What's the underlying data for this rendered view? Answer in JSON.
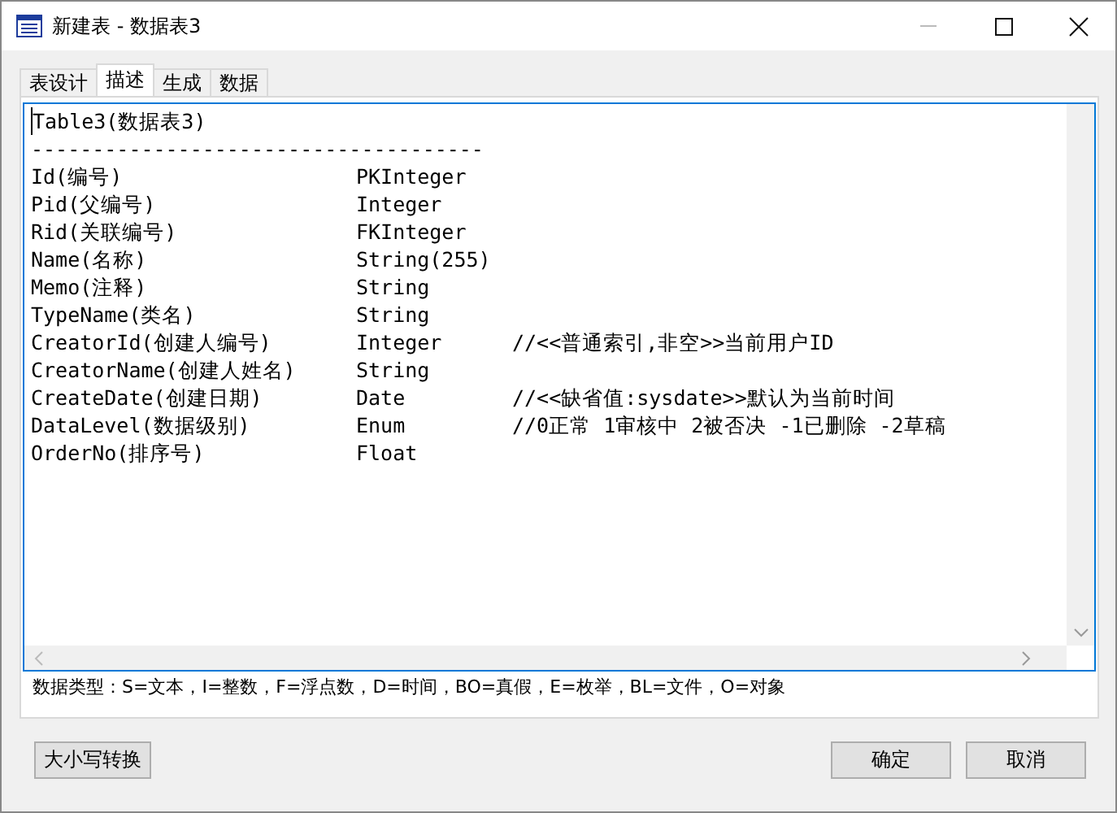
{
  "window": {
    "title": "新建表 - 数据表3"
  },
  "tabs": [
    {
      "label": "表设计",
      "selected": false
    },
    {
      "label": "描述",
      "selected": true
    },
    {
      "label": "生成",
      "selected": false
    },
    {
      "label": "数据",
      "selected": false
    }
  ],
  "editor": {
    "heading": "Table3(数据表3)",
    "separator": "-------------------------------------",
    "rows": [
      {
        "field": "Id(编号)",
        "type": "PKInteger"
      },
      {
        "field": "Pid(父编号)",
        "type": "Integer"
      },
      {
        "field": "Rid(关联编号)",
        "type": "FKInteger"
      },
      {
        "field": "Name(名称)",
        "type": "String(255)"
      },
      {
        "field": "Memo(注释)",
        "type": "String"
      },
      {
        "field": "TypeName(类名)",
        "type": "String"
      },
      {
        "field": "CreatorId(创建人编号)",
        "type": "Integer",
        "comment": "//<<普通索引,非空>>当前用户ID"
      },
      {
        "field": "CreatorName(创建人姓名)",
        "type": "String"
      },
      {
        "field": "CreateDate(创建日期)",
        "type": "Date",
        "comment": "//<<缺省值:sysdate>>默认为当前时间"
      },
      {
        "field": "DataLevel(数据级别)",
        "type": "Enum",
        "comment": "//0正常 1审核中 2被否决 -1已删除 -2草稿"
      },
      {
        "field": "OrderNo(排序号)",
        "type": "Float"
      }
    ]
  },
  "legend": "数据类型：S=文本，I=整数，F=浮点数，D=时间，BO=真假，E=枚举，BL=文件，O=对象",
  "buttons_left": [
    "大小写转换"
  ],
  "buttons_right": [
    "确定",
    "取消"
  ]
}
